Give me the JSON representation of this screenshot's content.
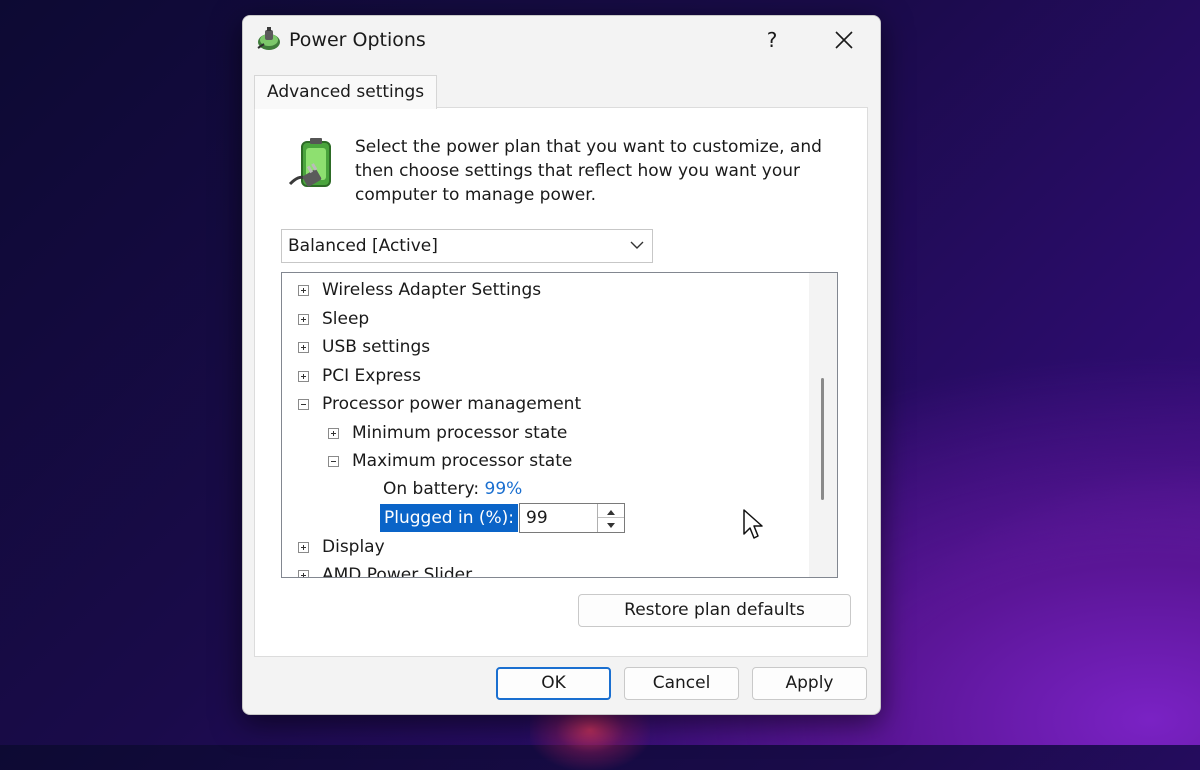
{
  "window": {
    "title": "Power Options",
    "help_label": "?",
    "close_icon": "close-icon"
  },
  "tab": {
    "label": "Advanced settings"
  },
  "intro": {
    "text": "Select the power plan that you want to customize, and then choose settings that reflect how you want your computer to manage power."
  },
  "plan_select": {
    "value": "Balanced [Active]"
  },
  "tree": {
    "items": [
      {
        "label": "Wireless Adapter Settings",
        "state": "collapsed"
      },
      {
        "label": "Sleep",
        "state": "collapsed"
      },
      {
        "label": "USB settings",
        "state": "collapsed"
      },
      {
        "label": "PCI Express",
        "state": "collapsed"
      },
      {
        "label": "Processor power management",
        "state": "expanded"
      },
      {
        "label": "Minimum processor state",
        "state": "collapsed"
      },
      {
        "label": "Maximum processor state",
        "state": "expanded"
      },
      {
        "label": "Display",
        "state": "collapsed"
      },
      {
        "label": "AMD Power Slider",
        "state": "collapsed"
      }
    ],
    "on_battery_label": "On battery:",
    "on_battery_value": "99%",
    "plugged_in_label": "Plugged in (%):",
    "plugged_in_value": "99"
  },
  "buttons": {
    "restore": "Restore plan defaults",
    "ok": "OK",
    "cancel": "Cancel",
    "apply": "Apply"
  },
  "colors": {
    "accent": "#0a64c8",
    "link_value": "#1a6fd0"
  }
}
